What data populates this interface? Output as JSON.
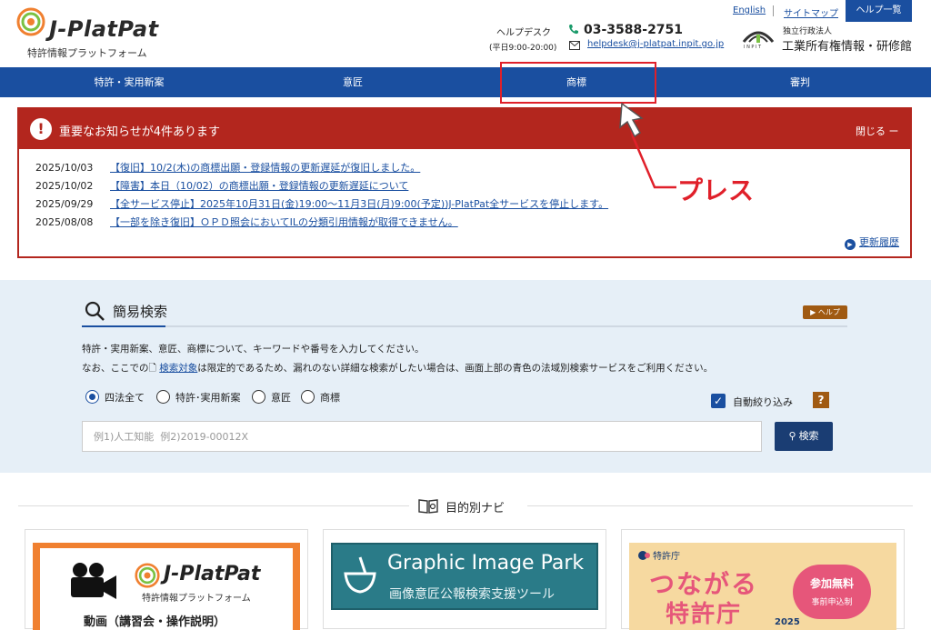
{
  "header": {
    "logo_title": "J-PlatPat",
    "logo_subtitle": "特許情報プラットフォーム",
    "helpdesk_label": "ヘルプデスク",
    "helpdesk_hours": "(平日9:00-20:00)",
    "phone": "03-3588-2751",
    "email": "helpdesk@j-platpat.inpit.go.jp",
    "english": "English",
    "sitemap": "サイトマップ",
    "help_list": "ヘルプ一覧",
    "org_small": "独立行政法人",
    "org_name": "工業所有権情報・研修館"
  },
  "nav": {
    "items": [
      {
        "label": "特許・実用新案"
      },
      {
        "label": "意匠"
      },
      {
        "label": "商標"
      },
      {
        "label": "審判"
      }
    ],
    "highlighted": "商標"
  },
  "annotation": {
    "label": "プレス",
    "color": "#e0202a"
  },
  "notice": {
    "title": "重要なお知らせが4件あります",
    "close": "閉じる ー",
    "items": [
      {
        "date": "2025/10/03",
        "text": "【復旧】10/2(木)の商標出願・登録情報の更新遅延が復旧しました。"
      },
      {
        "date": "2025/10/02",
        "text": "【障害】本日（10/02）の商標出願・登録情報の更新遅延について"
      },
      {
        "date": "2025/09/29",
        "text": "【全サービス停止】2025年10月31日(金)19:00〜11月3日(月)9:00(予定))J-PlatPat全サービスを停止します。"
      },
      {
        "date": "2025/08/08",
        "text": "【一部を除き復旧】ＯＰＤ照会においてILの分類引用情報が取得できません。"
      }
    ],
    "history": "更新履歴",
    "color": "#b3261e"
  },
  "search": {
    "heading": "簡易検索",
    "help": "▶ ヘルプ",
    "desc1": "特許・実用新案、意匠、商標について、キーワードや番号を入力してください。",
    "desc2_prefix": "なお、ここでの",
    "desc2_link": "検索対象",
    "desc2_suffix": "は限定的であるため、漏れのない詳細な検索がしたい場合は、画面上部の青色の法域別検索サービスをご利用ください。",
    "options": [
      {
        "label": "四法全て",
        "selected": true
      },
      {
        "label": "特許･実用新案",
        "selected": false
      },
      {
        "label": "意匠",
        "selected": false
      },
      {
        "label": "商標",
        "selected": false
      }
    ],
    "auto_filter": "自動絞り込み",
    "auto_filter_checked": true,
    "question": "?",
    "placeholder": "例1)人工知能  例2)2019-00012X",
    "button": "検索"
  },
  "purpose_nav": {
    "title": "目的別ナビ",
    "cards": [
      {
        "title": "J-PlatPat",
        "subtitle": "特許情報プラットフォーム",
        "text": "動画（講習会・操作説明）"
      },
      {
        "title": "Graphic Image Park",
        "subtitle": "画像意匠公報検索支援ツール"
      },
      {
        "label": "特許庁",
        "line1": "つながる",
        "line2": "特許庁",
        "year": "2025",
        "badge1": "参加無料",
        "badge2": "事前申込制"
      }
    ]
  },
  "colors": {
    "brand_blue": "#1a4fa0",
    "alert_red": "#b3261e",
    "search_bg": "#e6eff7",
    "help_brown": "#a05a12"
  }
}
